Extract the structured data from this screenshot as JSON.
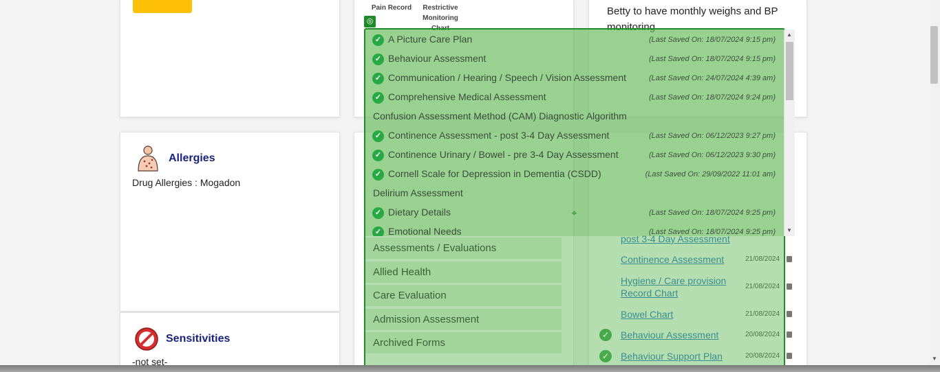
{
  "left": {
    "allergies": {
      "title": "Allergies",
      "text": "Drug Allergies : Mogadon"
    },
    "sensitivities": {
      "title": "Sensitivities",
      "text": "-not set-"
    }
  },
  "middle": {
    "headers": [
      "Pain Record",
      "Restrictive Monitoring Chart"
    ],
    "categories": [
      "Assessments / Evaluations",
      "Allied Health",
      "Care Evaluation",
      "Admission Assessment",
      "Archived Forms"
    ]
  },
  "right": {
    "note": "Betty to have monthly weighs and BP monitoring",
    "forms": [
      {
        "name": "post 3-4 Day Assessment",
        "date": "",
        "checked": false
      },
      {
        "name": "Continence Assessment",
        "date": "21/08/2024",
        "checked": false
      },
      {
        "name": "Hygiene / Care provision Record Chart",
        "date": "21/08/2024",
        "checked": false
      },
      {
        "name": "Bowel Chart",
        "date": "21/08/2024",
        "checked": false
      },
      {
        "name": "Behaviour Assessment",
        "date": "20/08/2024",
        "checked": true
      },
      {
        "name": "Behaviour Support Plan",
        "date": "20/08/2024",
        "checked": true
      }
    ]
  },
  "dropdown": {
    "items": [
      {
        "name": "A Picture Care Plan",
        "saved": "(Last Saved On: 18/07/2024 9:15 pm)",
        "checked": true
      },
      {
        "name": "Behaviour Assessment",
        "saved": "(Last Saved On: 18/07/2024 9:15 pm)",
        "checked": true
      },
      {
        "name": "Communication / Hearing / Speech / Vision Assessment",
        "saved": "(Last Saved On: 24/07/2024 4:39 am)",
        "checked": true
      },
      {
        "name": "Comprehensive Medical Assessment",
        "saved": "(Last Saved On: 18/07/2024 9:24 pm)",
        "checked": true
      },
      {
        "name": "Confusion Assessment Method (CAM) Diagnostic Algorithm",
        "saved": "",
        "checked": false
      },
      {
        "name": "Continence Assessment - post 3-4 Day Assessment",
        "saved": "(Last Saved On: 06/12/2023 9:27 pm)",
        "checked": true
      },
      {
        "name": "Continence Urinary / Bowel - pre 3-4 Day Assessment",
        "saved": "(Last Saved On: 06/12/2023 9:30 pm)",
        "checked": true
      },
      {
        "name": "Cornell Scale for Depression in Dementia (CSDD)",
        "saved": "(Last Saved On: 29/09/2022 11:01 am)",
        "checked": true
      },
      {
        "name": "Delirium Assessment",
        "saved": "",
        "checked": false
      },
      {
        "name": "Dietary Details",
        "saved": "(Last Saved On: 18/07/2024 9:25 pm)",
        "checked": true
      },
      {
        "name": "Emotional Needs",
        "saved": "(Last Saved On: 18/07/2024 9:25 pm)",
        "checked": true
      }
    ]
  },
  "icons": {
    "check": "check-circle-icon",
    "allergy": "allergy-body-icon",
    "sensitivity": "no-entry-icon",
    "target": "crosshair-icon",
    "document": "document-icon"
  },
  "colors": {
    "overlay": "#1f8a28",
    "accent": "#1565c0",
    "heading": "#1a237e",
    "yellow": "#ffc107"
  }
}
